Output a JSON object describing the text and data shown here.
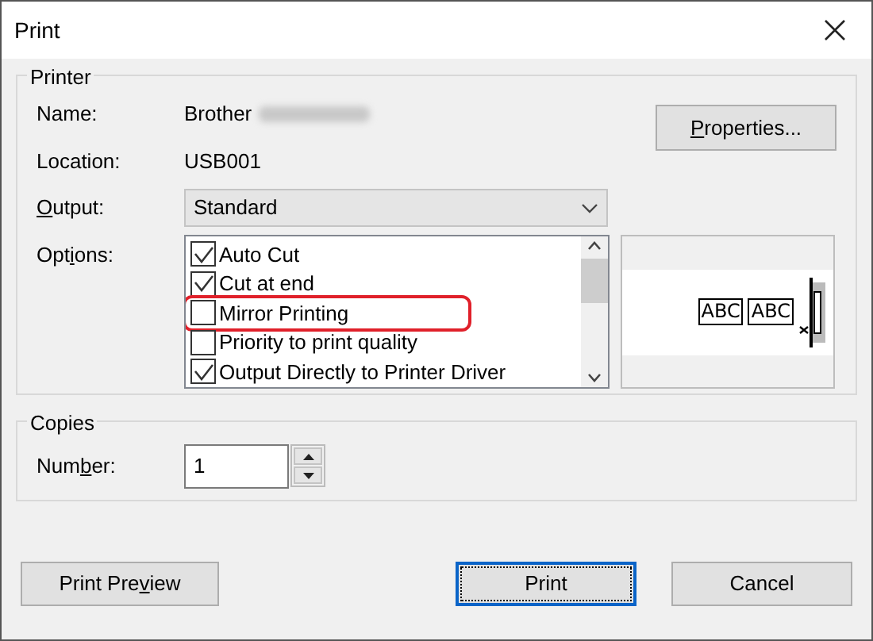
{
  "window": {
    "title": "Print"
  },
  "printer": {
    "group_title": "Printer",
    "name_label": "Name:",
    "name_value": "Brother",
    "name_redacted": true,
    "location_label": "Location:",
    "location_value": "USB001",
    "properties_button": {
      "label": [
        {
          "text": "P",
          "underlined": true
        },
        {
          "text": "roperties...",
          "underlined": false
        }
      ]
    },
    "output": {
      "label": [
        {
          "text": "O",
          "underlined": true
        },
        {
          "text": "utput:",
          "underlined": false
        }
      ],
      "value": "Standard"
    },
    "options_label": {
      "label": [
        {
          "text": "Opt",
          "underlined": false
        },
        {
          "text": "i",
          "underlined": true
        },
        {
          "text": "ons:",
          "underlined": false
        }
      ]
    },
    "options": [
      {
        "label": "Auto Cut",
        "checked": true,
        "highlighted": false
      },
      {
        "label": "Cut at end",
        "checked": true,
        "highlighted": false
      },
      {
        "label": "Mirror Printing",
        "checked": false,
        "highlighted": true
      },
      {
        "label": "Priority to print quality",
        "checked": false,
        "highlighted": false
      },
      {
        "label": "Output Directly to Printer Driver",
        "checked": true,
        "highlighted": false
      }
    ],
    "preview_labels": [
      "ABC",
      "ABC"
    ]
  },
  "copies": {
    "group_title": "Copies",
    "number_label": [
      {
        "text": "Num",
        "underlined": false
      },
      {
        "text": "b",
        "underlined": true
      },
      {
        "text": "er:",
        "underlined": false
      }
    ],
    "value": "1"
  },
  "buttons": [
    {
      "label": [
        {
          "text": "Print Pre",
          "underlined": false
        },
        {
          "text": "v",
          "underlined": true
        },
        {
          "text": "iew",
          "underlined": false
        }
      ],
      "default": false
    },
    {
      "label": [
        {
          "text": "Print",
          "underlined": false
        }
      ],
      "default": true
    },
    {
      "label": [
        {
          "text": "Cancel",
          "underlined": false
        }
      ],
      "default": false
    }
  ]
}
